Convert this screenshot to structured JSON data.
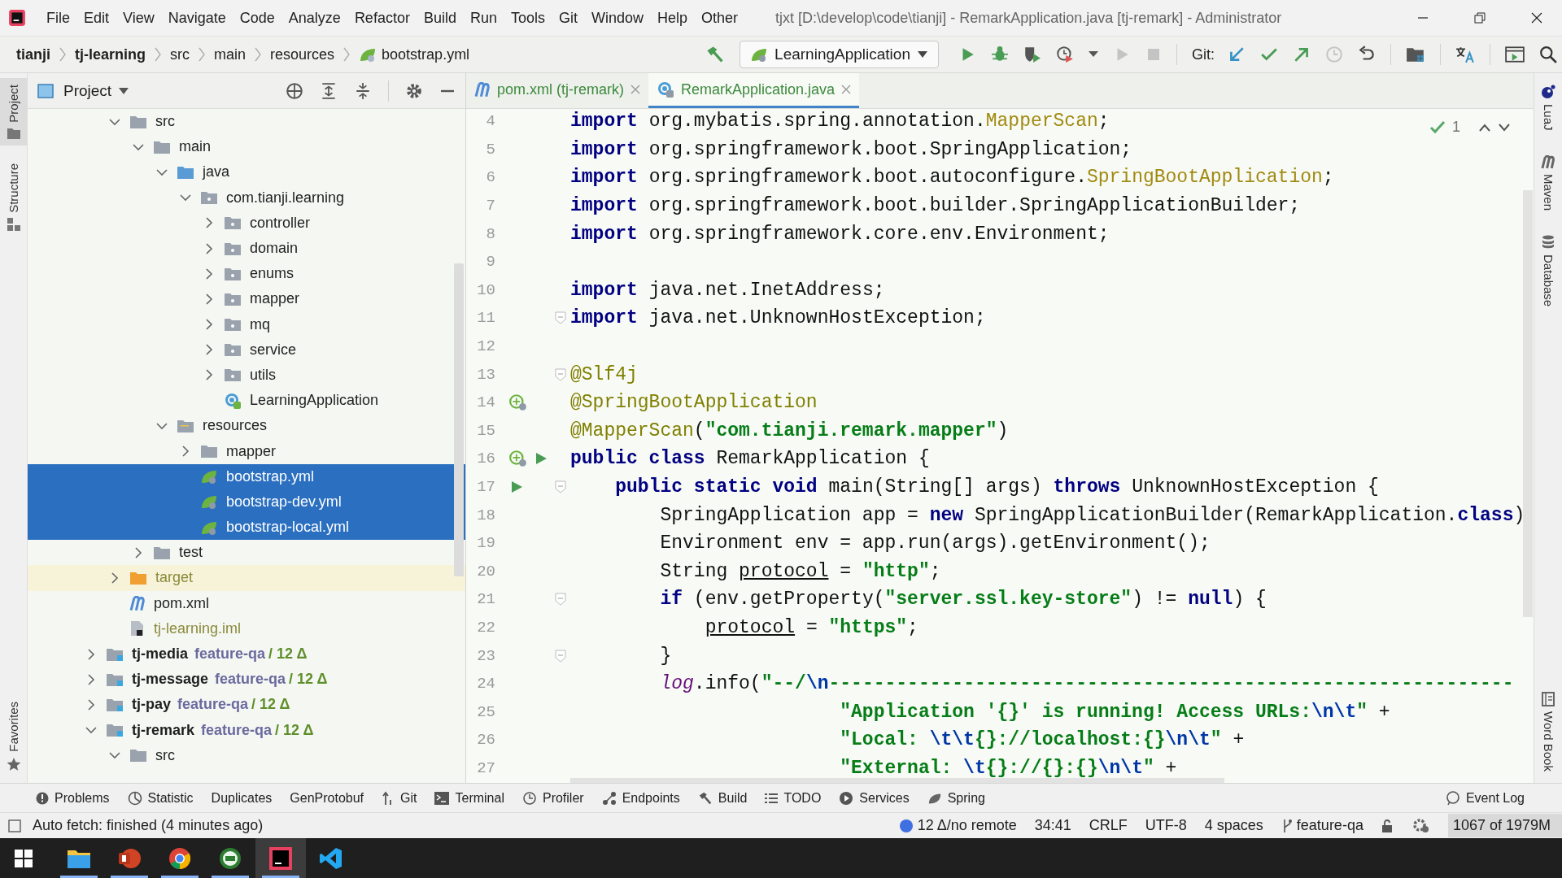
{
  "menu": [
    "File",
    "Edit",
    "View",
    "Navigate",
    "Code",
    "Analyze",
    "Refactor",
    "Build",
    "Run",
    "Tools",
    "Git",
    "Window",
    "Help",
    "Other"
  ],
  "title": "tjxt [D:\\develop\\code\\tianji] - RemarkApplication.java [tj-remark] - Administrator",
  "breadcrumb": [
    {
      "label": "tianji",
      "bold": true
    },
    {
      "label": "tj-learning",
      "bold": true
    },
    {
      "label": "src",
      "bold": false
    },
    {
      "label": "main",
      "bold": false
    },
    {
      "label": "resources",
      "bold": false
    },
    {
      "label": "bootstrap.yml",
      "bold": false,
      "kind": "yml"
    }
  ],
  "run_config": "LearningApplication",
  "git_label": "Git:",
  "toolbar": [
    {
      "kind": "run",
      "disabled": false
    },
    {
      "kind": "debug",
      "disabled": false
    },
    {
      "kind": "coverage",
      "disabled": false
    },
    {
      "kind": "profile",
      "disabled": false
    },
    {
      "kind": "caret",
      "disabled": false
    },
    {
      "kind": "run",
      "disabled": true
    },
    {
      "kind": "stop",
      "disabled": true
    }
  ],
  "git_tools": [
    {
      "kind": "update",
      "disabled": false
    },
    {
      "kind": "commit",
      "disabled": false
    },
    {
      "kind": "push",
      "disabled": false
    },
    {
      "kind": "history",
      "disabled": true
    },
    {
      "kind": "rollback",
      "disabled": false
    }
  ],
  "left_tabs": [
    {
      "label": "Project",
      "selected": true
    },
    {
      "label": "Structure",
      "selected": false
    }
  ],
  "left_bottom_tabs": [
    {
      "label": "Favorites",
      "selected": false
    }
  ],
  "right_tabs": [
    {
      "label": "LuaJ",
      "kind": "lua"
    },
    {
      "label": "Maven",
      "kind": "maven"
    },
    {
      "label": "Database",
      "kind": "database"
    },
    {
      "label": "Word Book",
      "kind": "book"
    }
  ],
  "project_panel": {
    "title": "Project"
  },
  "tree": [
    {
      "label": "src",
      "kind": "folder",
      "expanded": true,
      "selected": false,
      "children": [
        {
          "label": "main",
          "kind": "folder",
          "expanded": true,
          "selected": false,
          "children": [
            {
              "label": "java",
              "kind": "source",
              "expanded": true,
              "selected": false,
              "children": [
                {
                  "label": "com.tianji.learning",
                  "kind": "package",
                  "expanded": true,
                  "selected": false,
                  "children": [
                    {
                      "label": "controller",
                      "kind": "package",
                      "expanded": false,
                      "selected": false
                    },
                    {
                      "label": "domain",
                      "kind": "package",
                      "expanded": false,
                      "selected": false
                    },
                    {
                      "label": "enums",
                      "kind": "package",
                      "expanded": false,
                      "selected": false
                    },
                    {
                      "label": "mapper",
                      "kind": "package",
                      "expanded": false,
                      "selected": false
                    },
                    {
                      "label": "mq",
                      "kind": "package",
                      "expanded": false,
                      "selected": false
                    },
                    {
                      "label": "service",
                      "kind": "package",
                      "expanded": false,
                      "selected": false
                    },
                    {
                      "label": "utils",
                      "kind": "package",
                      "expanded": false,
                      "selected": false
                    },
                    {
                      "label": "LearningApplication",
                      "kind": "class",
                      "selected": false
                    }
                  ]
                }
              ]
            },
            {
              "label": "resources",
              "kind": "resources",
              "expanded": true,
              "selected": false,
              "children": [
                {
                  "label": "mapper",
                  "kind": "folder",
                  "expanded": false,
                  "selected": false
                },
                {
                  "label": "bootstrap.yml",
                  "kind": "yml",
                  "selected": true
                },
                {
                  "label": "bootstrap-dev.yml",
                  "kind": "yml",
                  "selected": true
                },
                {
                  "label": "bootstrap-local.yml",
                  "kind": "yml",
                  "selected": true
                }
              ]
            }
          ]
        },
        {
          "label": "test",
          "kind": "folder",
          "expanded": false,
          "selected": false
        }
      ]
    },
    {
      "label": "target",
      "kind": "excluded",
      "expanded": false,
      "selected": false
    },
    {
      "label": "pom.xml",
      "kind": "maven",
      "selected": false
    },
    {
      "label": "tj-learning.iml",
      "kind": "iml",
      "selected": false
    }
  ],
  "modules": [
    {
      "label": "tj-media",
      "kind": "module",
      "branch": "feature-qa",
      "changes": "/ 12 Δ",
      "expanded": false,
      "selected": false
    },
    {
      "label": "tj-message",
      "kind": "module",
      "branch": "feature-qa",
      "changes": "/ 12 Δ",
      "expanded": false,
      "selected": false
    },
    {
      "label": "tj-pay",
      "kind": "module",
      "branch": "feature-qa",
      "changes": "/ 12 Δ",
      "expanded": false,
      "selected": false
    },
    {
      "label": "tj-remark",
      "kind": "module",
      "branch": "feature-qa",
      "changes": "/ 12 Δ",
      "expanded": true,
      "selected": false,
      "children": [
        {
          "label": "src",
          "kind": "folder",
          "expanded": true,
          "selected": false
        }
      ]
    }
  ],
  "tabs": [
    {
      "label": "pom.xml (tj-remark)",
      "kind": "maven",
      "selected": false
    },
    {
      "label": "RemarkApplication.java",
      "kind": "class",
      "selected": true
    }
  ],
  "inspection": {
    "count": "1"
  },
  "code": [
    {
      "n": "4",
      "tokens": [
        {
          "text": "import",
          "kind": "kw"
        },
        {
          "text": " org.mybatis.spring.annotation.",
          "kind": "p"
        },
        {
          "text": "MapperScan",
          "kind": "unused"
        },
        {
          "text": ";",
          "kind": "p"
        }
      ]
    },
    {
      "n": "5",
      "tokens": [
        {
          "text": "import",
          "kind": "kw"
        },
        {
          "text": " org.springframework.boot.SpringApplication;",
          "kind": "p"
        }
      ]
    },
    {
      "n": "6",
      "tokens": [
        {
          "text": "import",
          "kind": "kw"
        },
        {
          "text": " org.springframework.boot.autoconfigure.",
          "kind": "p"
        },
        {
          "text": "SpringBootApplication",
          "kind": "unused"
        },
        {
          "text": ";",
          "kind": "p"
        }
      ]
    },
    {
      "n": "7",
      "tokens": [
        {
          "text": "import",
          "kind": "kw"
        },
        {
          "text": " org.springframework.boot.builder.SpringApplicationBuilder;",
          "kind": "p"
        }
      ]
    },
    {
      "n": "8",
      "tokens": [
        {
          "text": "import",
          "kind": "kw"
        },
        {
          "text": " org.springframework.core.env.Environment;",
          "kind": "p"
        }
      ]
    },
    {
      "n": "9"
    },
    {
      "n": "10",
      "tokens": [
        {
          "text": "import",
          "kind": "kw"
        },
        {
          "text": " java.net.InetAddress;",
          "kind": "p"
        }
      ]
    },
    {
      "n": "11",
      "fold": true,
      "tokens": [
        {
          "text": "import",
          "kind": "kw"
        },
        {
          "text": " java.net.UnknownHostException;",
          "kind": "p"
        }
      ]
    },
    {
      "n": "12"
    },
    {
      "n": "13",
      "fold": true,
      "tokens": [
        {
          "text": "@Slf4j",
          "kind": "ann"
        }
      ]
    },
    {
      "n": "14",
      "gutter": [
        {
          "kind": "bean"
        }
      ],
      "tokens": [
        {
          "text": "@SpringBootApplication",
          "kind": "ann"
        }
      ]
    },
    {
      "n": "15",
      "tokens": [
        {
          "text": "@MapperScan",
          "kind": "ann"
        },
        {
          "text": "(",
          "kind": "p"
        },
        {
          "text": "\"com.tianji.remark.mapper\"",
          "kind": "str"
        },
        {
          "text": ")",
          "kind": "p"
        }
      ]
    },
    {
      "n": "16",
      "gutter": [
        {
          "kind": "bean"
        },
        {
          "kind": "run"
        }
      ],
      "tokens": [
        {
          "text": "public class",
          "kind": "kw"
        },
        {
          "text": " RemarkApplication {",
          "kind": "p"
        }
      ]
    },
    {
      "n": "17",
      "gutter": [
        {
          "kind": "run"
        }
      ],
      "fold": true,
      "tokens": [
        {
          "text": "    public static void",
          "kind": "kw"
        },
        {
          "text": " main(String[] args) ",
          "kind": "p"
        },
        {
          "text": "throws",
          "kind": "kw"
        },
        {
          "text": " UnknownHostException {",
          "kind": "p"
        }
      ]
    },
    {
      "n": "18",
      "tokens": [
        {
          "text": "        SpringApplication app = ",
          "kind": "p"
        },
        {
          "text": "new",
          "kind": "kw"
        },
        {
          "text": " SpringApplicationBuilder(RemarkApplication.",
          "kind": "p"
        },
        {
          "text": "class",
          "kind": "kw"
        },
        {
          "text": ")",
          "kind": "p"
        }
      ]
    },
    {
      "n": "19",
      "tokens": [
        {
          "text": "        Environment env = app.run(args).getEnvironment();",
          "kind": "p"
        }
      ]
    },
    {
      "n": "20",
      "tokens": [
        {
          "text": "        String ",
          "kind": "p"
        },
        {
          "text": "protocol",
          "kind": "reassigned"
        },
        {
          "text": " = ",
          "kind": "p"
        },
        {
          "text": "\"http\"",
          "kind": "str"
        },
        {
          "text": ";",
          "kind": "p"
        }
      ]
    },
    {
      "n": "21",
      "fold": true,
      "tokens": [
        {
          "text": "        if",
          "kind": "kw"
        },
        {
          "text": " (env.getProperty(",
          "kind": "p"
        },
        {
          "text": "\"server.ssl.key-store\"",
          "kind": "str"
        },
        {
          "text": ") != ",
          "kind": "p"
        },
        {
          "text": "null",
          "kind": "kw"
        },
        {
          "text": ") {",
          "kind": "p"
        }
      ]
    },
    {
      "n": "22",
      "tokens": [
        {
          "text": "            protocol",
          "kind": "reassigned"
        },
        {
          "text": " = ",
          "kind": "p"
        },
        {
          "text": "\"https\"",
          "kind": "str"
        },
        {
          "text": ";",
          "kind": "p"
        }
      ]
    },
    {
      "n": "23",
      "fold": true,
      "tokens": [
        {
          "text": "        }",
          "kind": "p"
        }
      ]
    },
    {
      "n": "24",
      "tokens": [
        {
          "text": "        log",
          "kind": "static"
        },
        {
          "text": ".info(",
          "kind": "p"
        },
        {
          "text": "\"--/",
          "kind": "str"
        },
        {
          "text": "\\n",
          "kind": "esc"
        },
        {
          "text": "-------------------------------------------------------------",
          "kind": "str"
        }
      ]
    },
    {
      "n": "25",
      "tokens": [
        {
          "text": "                        \"Application '{}' is running! Access URLs:",
          "kind": "str"
        },
        {
          "text": "\\n\\t",
          "kind": "esc"
        },
        {
          "text": "\"",
          "kind": "str"
        },
        {
          "text": " +",
          "kind": "p"
        }
      ]
    },
    {
      "n": "26",
      "tokens": [
        {
          "text": "                        \"Local: ",
          "kind": "str"
        },
        {
          "text": "\\t\\t",
          "kind": "esc"
        },
        {
          "text": "{}://localhost:{}",
          "kind": "str"
        },
        {
          "text": "\\n\\t",
          "kind": "esc"
        },
        {
          "text": "\"",
          "kind": "str"
        },
        {
          "text": " +",
          "kind": "p"
        }
      ]
    },
    {
      "n": "27",
      "tokens": [
        {
          "text": "                        \"External: ",
          "kind": "str"
        },
        {
          "text": "\\t",
          "kind": "esc"
        },
        {
          "text": "{}://{}:{}",
          "kind": "str"
        },
        {
          "text": "\\n\\t",
          "kind": "esc"
        },
        {
          "text": "\"",
          "kind": "str"
        },
        {
          "text": " +",
          "kind": "p"
        }
      ]
    }
  ],
  "tool_windows": [
    {
      "label": "Problems",
      "kind": "info"
    },
    {
      "label": "Statistic",
      "kind": "pie"
    },
    {
      "label": "Duplicates"
    },
    {
      "label": "GenProtobuf"
    },
    {
      "label": "Git",
      "kind": "vcs"
    },
    {
      "label": "Terminal",
      "kind": "terminal"
    },
    {
      "label": "Profiler",
      "kind": "clock"
    },
    {
      "label": "Endpoints",
      "kind": "nodes"
    },
    {
      "label": "Build",
      "kind": "hammer"
    },
    {
      "label": "TODO",
      "kind": "list"
    },
    {
      "label": "Services",
      "kind": "play"
    },
    {
      "label": "Spring",
      "kind": "leaf"
    }
  ],
  "event_log": "Event Log",
  "status": {
    "message": "Auto fetch: finished (4 minutes ago)",
    "vcs": "12 Δ/no remote",
    "items": [
      "34:41",
      "CRLF",
      "UTF-8",
      "4 spaces"
    ],
    "branch": "feature-qa",
    "memory": "1067 of 1979M"
  },
  "taskbar": [
    {
      "kind": "files",
      "running": true,
      "selected": false
    },
    {
      "kind": "slides",
      "running": true,
      "selected": false
    },
    {
      "kind": "browser",
      "running": true,
      "selected": false
    },
    {
      "kind": "tool",
      "running": true,
      "selected": false
    },
    {
      "kind": "ide",
      "running": true,
      "selected": true
    },
    {
      "kind": "editor",
      "running": false,
      "selected": false
    }
  ]
}
